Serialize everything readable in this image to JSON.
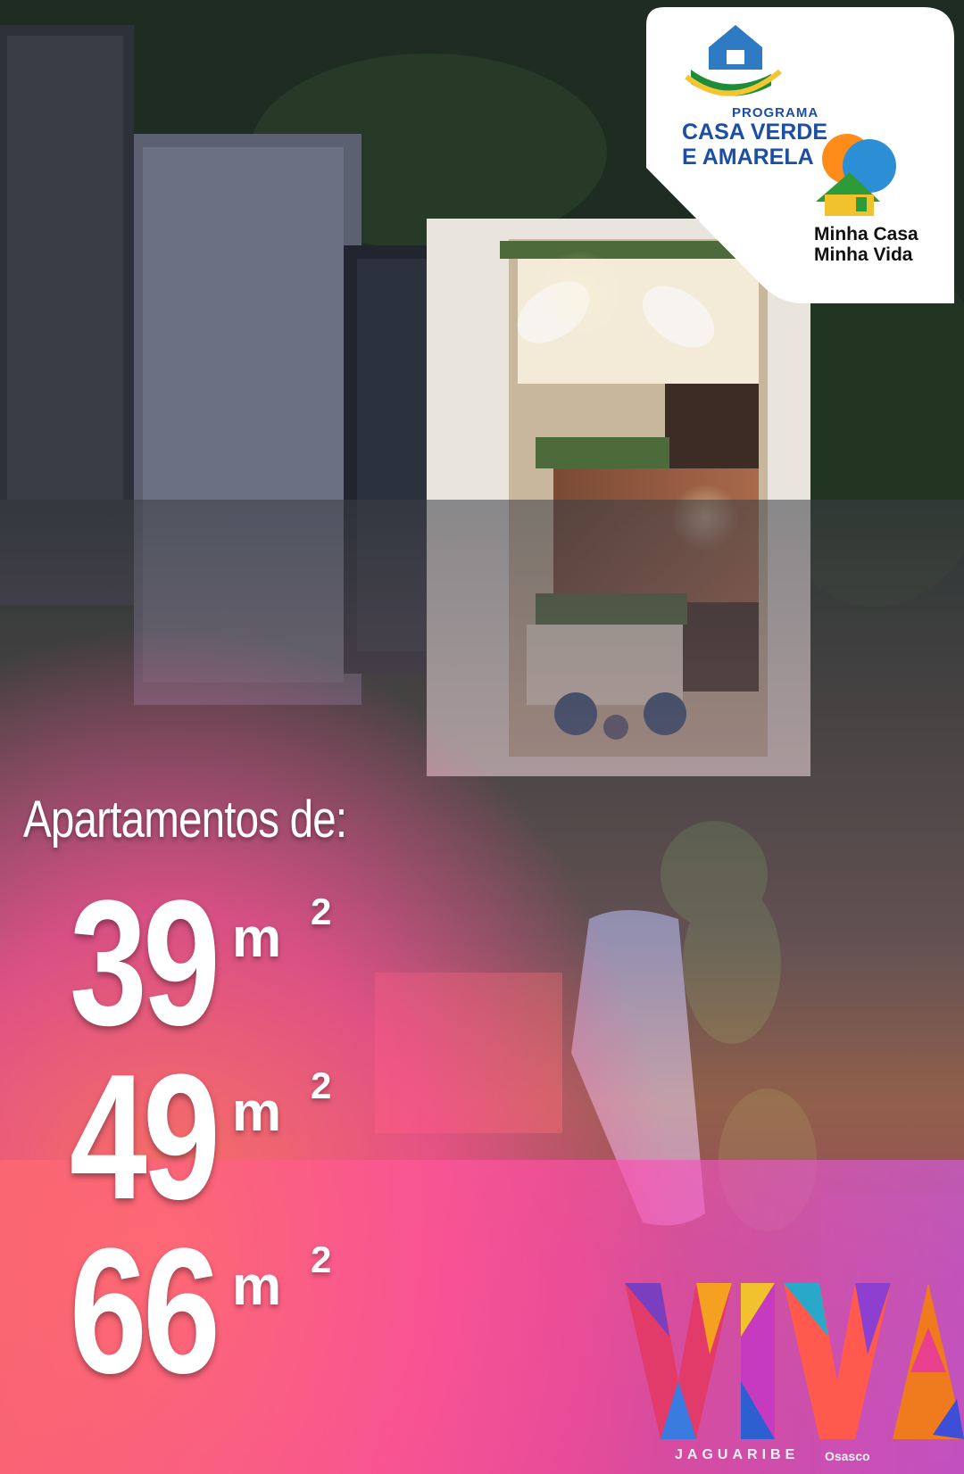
{
  "ad": {
    "tagline": "Apartamentos de:",
    "sizes": [
      {
        "value": "39",
        "unit": "m",
        "sup": "2"
      },
      {
        "value": "49",
        "unit": "m",
        "sup": "2"
      },
      {
        "value": "66",
        "unit": "m",
        "sup": "2"
      }
    ]
  },
  "badges": {
    "program_label": "PROGRAMA",
    "program_name_line1": "CASA VERDE",
    "program_name_line2": "E AMARELA",
    "mcmv_line1": "Minha Casa",
    "mcmv_line2": "Minha Vida"
  },
  "brand": {
    "logo_text": "VIVA",
    "subtitle": "JAGUARIBE",
    "city": "Osasco"
  },
  "colors": {
    "gradient_orange": "#f7a15a",
    "gradient_pink": "#ff4f9a",
    "gradient_magenta": "#e04bd0",
    "night_green": "#1d2b20",
    "badge_blue": "#1c4ea3"
  }
}
